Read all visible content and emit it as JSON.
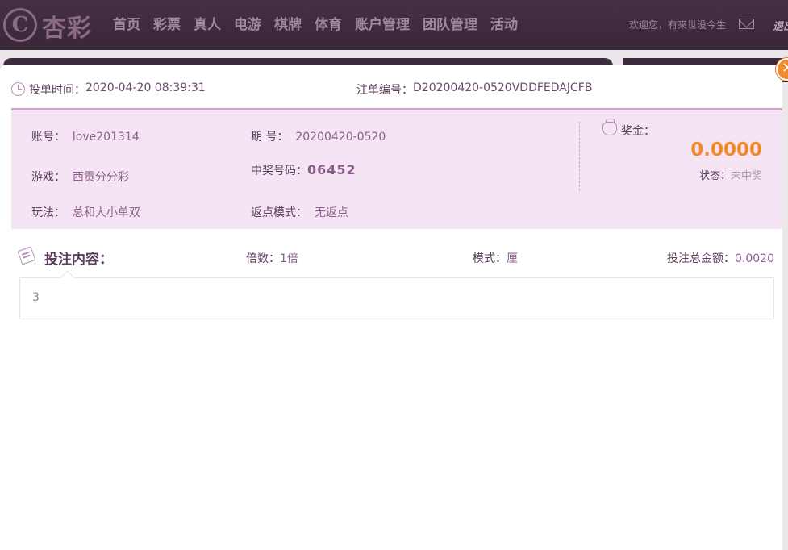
{
  "header": {
    "logo_mark": "C",
    "logo_text": "杏彩",
    "nav": [
      "首页",
      "彩票",
      "真人",
      "电游",
      "棋牌",
      "体育",
      "账户管理",
      "团队管理",
      "活动"
    ],
    "welcome": "欢迎您，有来世没今生",
    "logout": "退出"
  },
  "modal": {
    "close_symbol": "✕",
    "bet_time_label": "投单时间：",
    "bet_time": "2020-04-20 08:39:31",
    "order_no_label": "注单编号：",
    "order_no": "D20200420-0520VDDFEDAJCFB",
    "account_label": "账号：",
    "account": "love201314",
    "game_label": "游戏：",
    "game": "西贡分分彩",
    "play_label": "玩法：",
    "play": "总和大小单双",
    "period_label": "期 号：",
    "period": "20200420-0520",
    "win_code_label": "中奖号码：",
    "win_code": "06452",
    "rebate_label": "返点模式：",
    "rebate": "无返点",
    "prize_label": "奖金：",
    "prize": "0.0000",
    "status_label": "状态：",
    "status": "未中奖",
    "content_title": "投注内容：",
    "multiple_label": "倍数：",
    "multiple": "1倍",
    "mode_label": "模式：",
    "mode": "厘",
    "total_label": "投注总金额：",
    "total": "0.0020",
    "content": "3"
  },
  "colors": {
    "brand_purple": "#3c2b3c",
    "accent_orange": "#f08a2a",
    "info_bg": "#f5e5f4"
  }
}
